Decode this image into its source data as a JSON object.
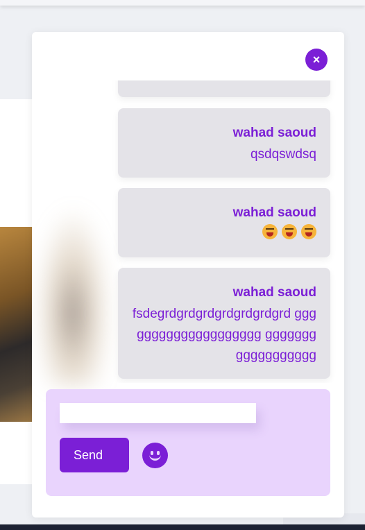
{
  "chat": {
    "close_label": "×",
    "messages": [
      {
        "sender": "wahad saoud",
        "text": "qsdqswdsq"
      },
      {
        "sender": "wahad saoud",
        "text": "😝😝😝"
      },
      {
        "sender": "wahad saoud",
        "text": "fsdegrdgrdgrdgrdgrdgrdgrd gggggggggggggggggggg gggggggggggggggggg"
      }
    ],
    "composer": {
      "input_value": "",
      "send_label": "Send"
    }
  },
  "icons": {
    "close": "close-icon",
    "emoji_picker": "smiley-icon",
    "message_emoji": "grinning-squinting-tongue-emoji"
  },
  "colors": {
    "accent": "#7b1fd6",
    "bubble_bg": "#e4e3e8",
    "composer_bg": "#e9d4fd"
  }
}
